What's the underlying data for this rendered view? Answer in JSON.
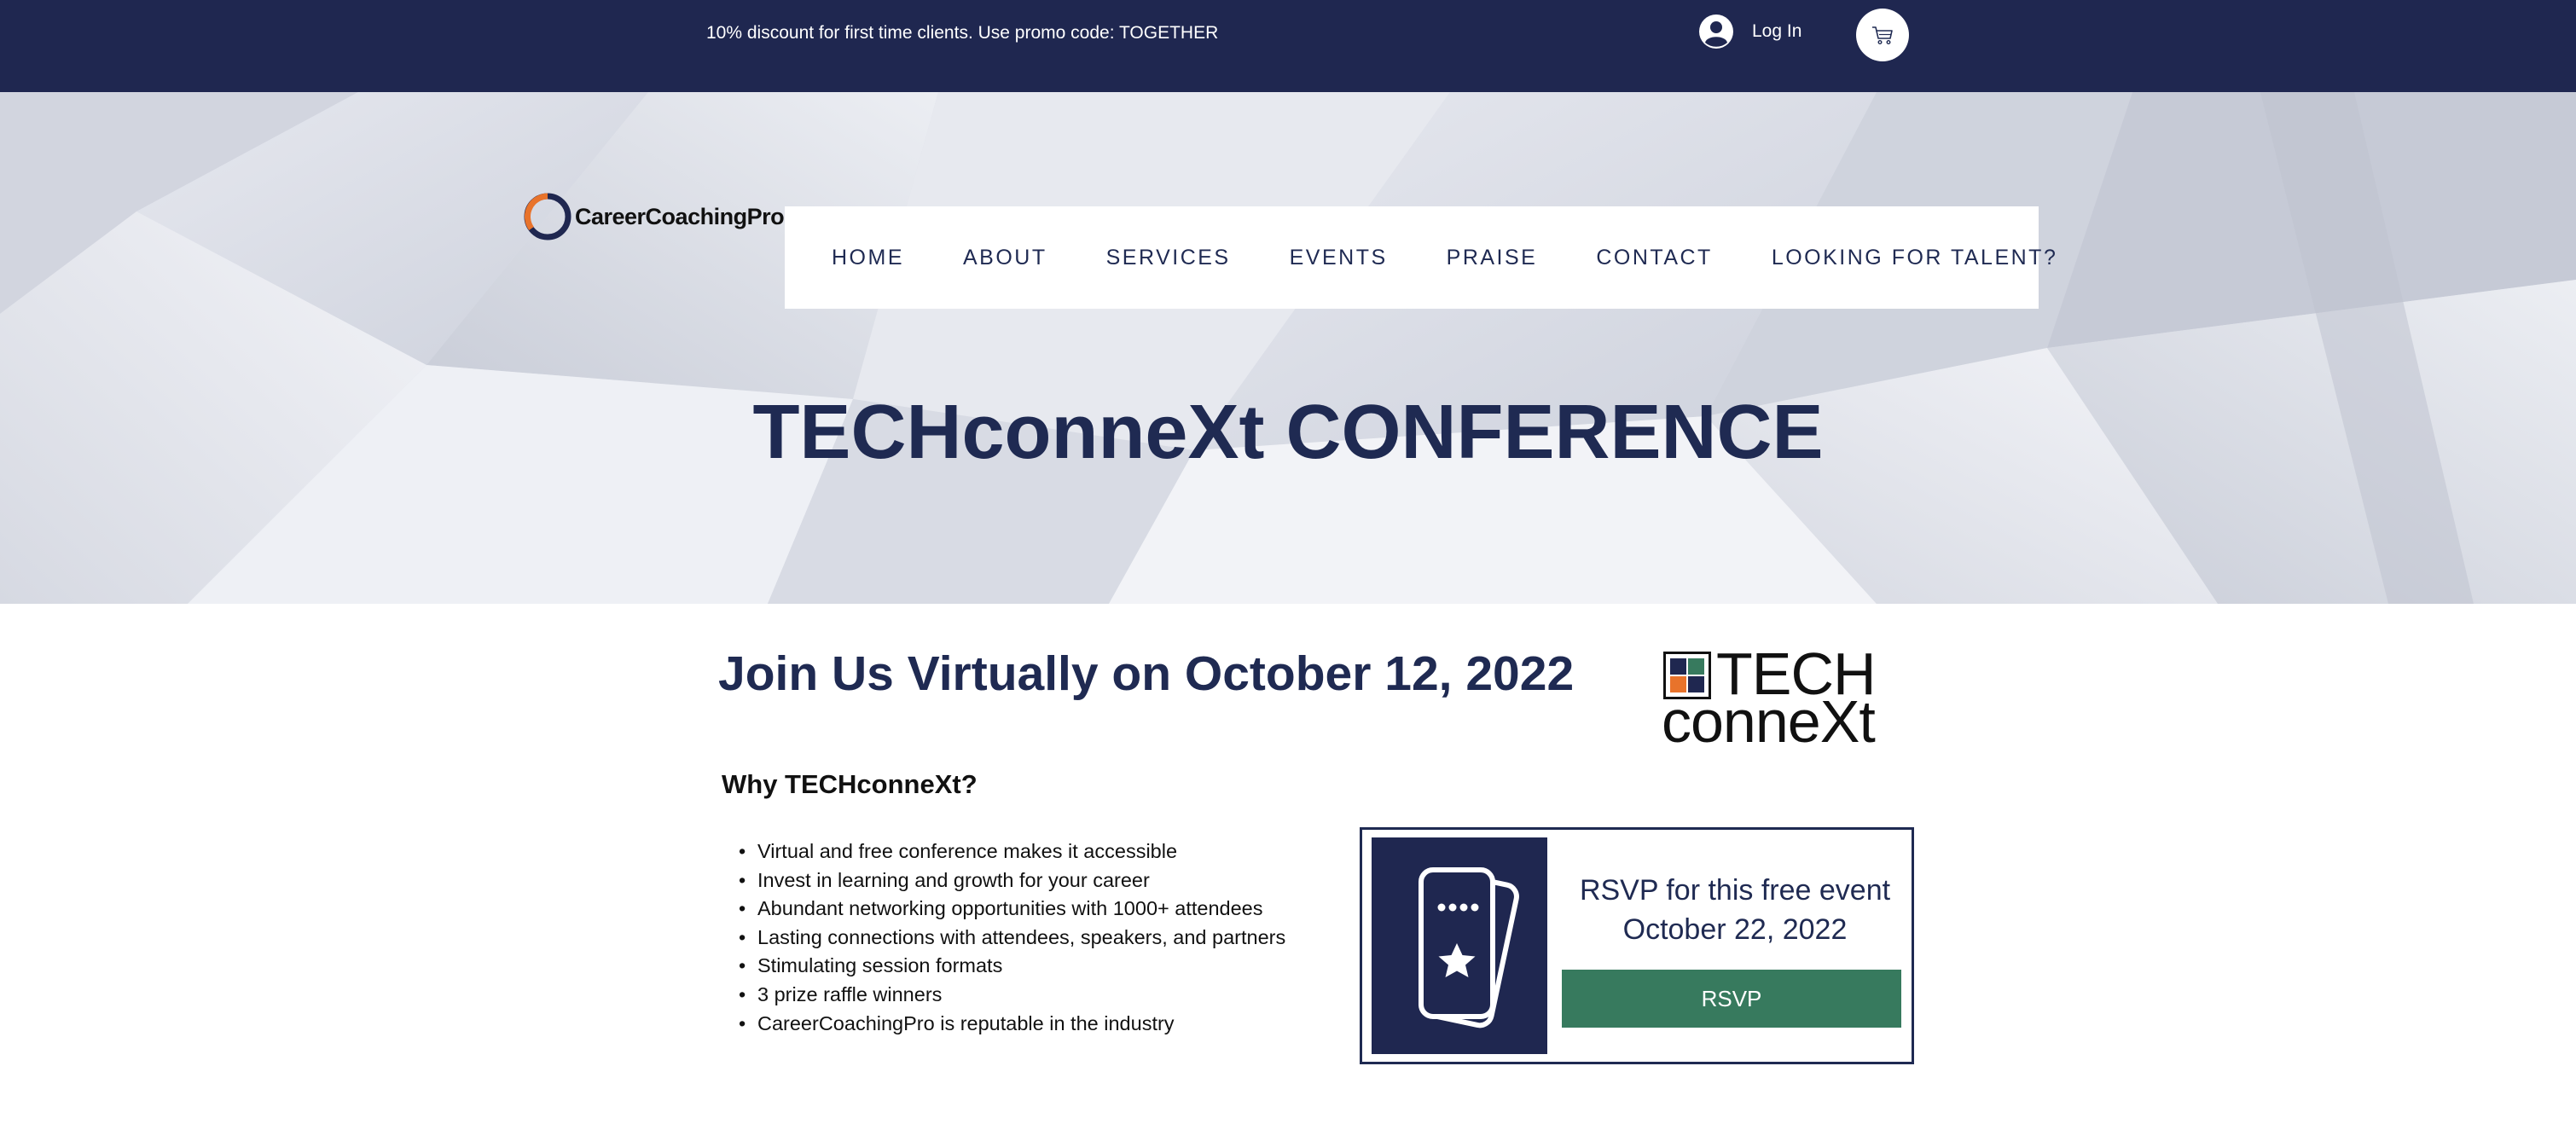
{
  "promo_bar": {
    "text": "10% discount for first time clients. Use promo code: TOGETHER",
    "login_label": "Log In",
    "user_icon": "user-avatar-icon",
    "cart_icon": "shopping-cart-icon",
    "background_color": "#1f2750"
  },
  "header": {
    "logo_text": "CareerCoachingPro",
    "nav": [
      {
        "label": "HOME"
      },
      {
        "label": "ABOUT"
      },
      {
        "label": "SERVICES"
      },
      {
        "label": "EVENTS"
      },
      {
        "label": "PRAISE"
      },
      {
        "label": "CONTACT"
      },
      {
        "label": "LOOKING FOR TALENT?"
      }
    ]
  },
  "hero": {
    "title": "TECHconneXt CONFERENCE"
  },
  "main": {
    "join_title": "Join Us Virtually on October 12, 2022",
    "tech_logo": {
      "line1": "TECH",
      "line2": "conneXt"
    },
    "why_title": "Why TECHconneXt?",
    "benefits": [
      "Virtual and free conference makes it accessible",
      "Invest in learning and growth for your career",
      "Abundant networking opportunities with 1000+ attendees",
      "Lasting connections with attendees, speakers, and partners",
      "Stimulating session formats",
      "3 prize raffle winners",
      "CareerCoachingPro is reputable in the industry"
    ]
  },
  "rsvp": {
    "heading_line1": "RSVP for this free event",
    "heading_line2": "October 22, 2022",
    "button_label": "RSVP",
    "icon": "mobile-ticket-star-icon",
    "accent_color": "#1f2a52",
    "button_color": "#377a5e"
  }
}
